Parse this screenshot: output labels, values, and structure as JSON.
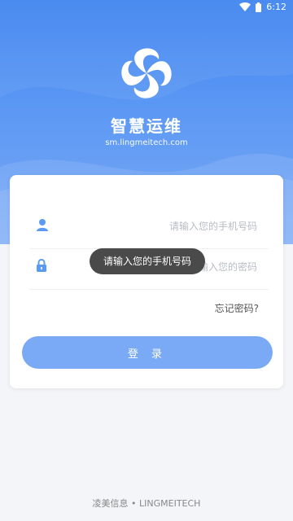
{
  "status_bar": {
    "time": "6:12",
    "icons": [
      "wifi-icon",
      "battery-icon"
    ]
  },
  "brand": {
    "title": "智慧运维",
    "domain": "sm.lingmeitech.com"
  },
  "form": {
    "phone_placeholder": "请输入您的手机号码",
    "password_placeholder": "请输入您的密码",
    "forgot_label": "忘记密码?",
    "login_label": "登 录"
  },
  "toast": {
    "message": "请输入您的手机号码"
  },
  "footer": {
    "text": "凌美信息 • LINGMEITECH"
  },
  "colors": {
    "header_top": "#3f84f0",
    "header_bottom": "#7aaaf5",
    "accent": "#5b9af2",
    "button": "#7aaaf5",
    "toast_bg": "#4a4a4a"
  }
}
